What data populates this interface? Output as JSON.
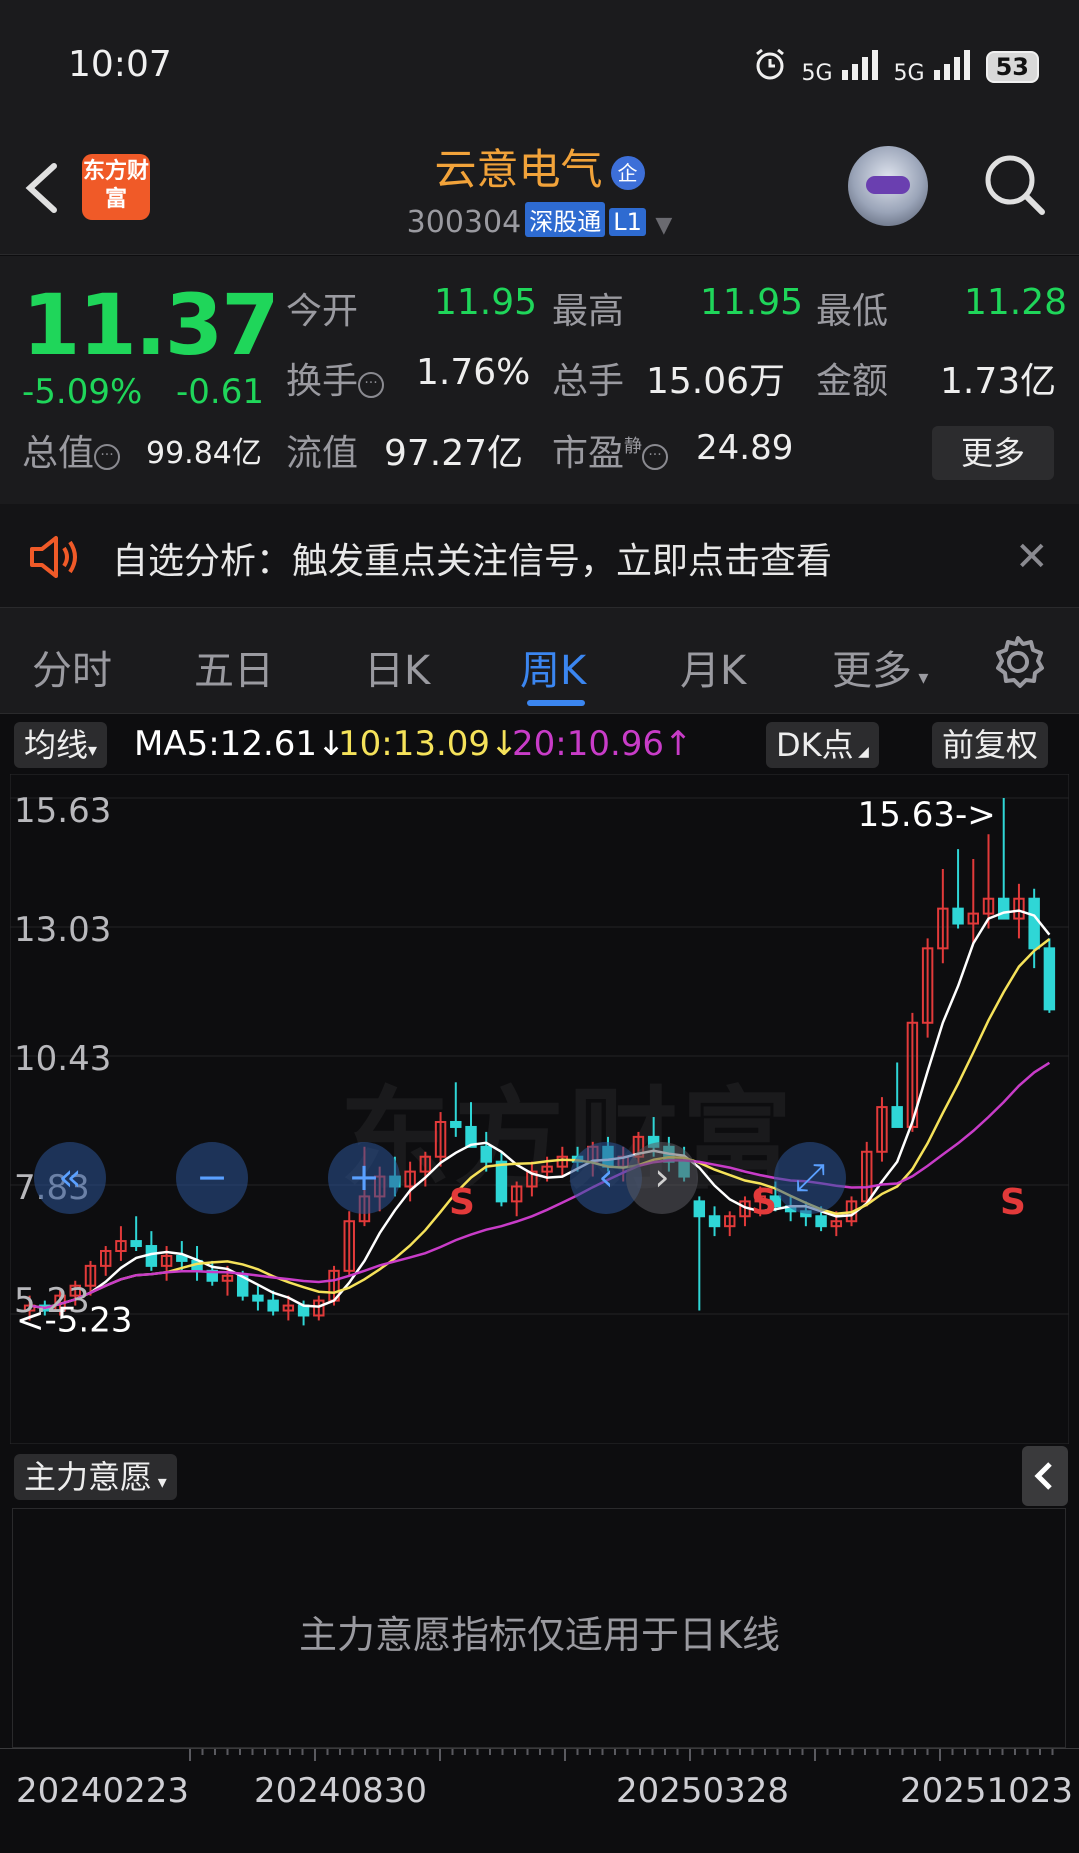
{
  "status": {
    "time": "10:07",
    "net1": "5G",
    "net2": "5G",
    "battery": "53"
  },
  "header": {
    "logo_text": "东方财富",
    "stock_name": "云意电气",
    "name_badge": "企",
    "code": "300304",
    "tag1": "深股通",
    "tag2": "L1"
  },
  "quote": {
    "price": "11.37",
    "change_pct": "-5.09%",
    "change_abs": "-0.61",
    "open_label": "今开",
    "open": "11.95",
    "high_label": "最高",
    "high": "11.95",
    "low_label": "最低",
    "low": "11.28",
    "turnover_label": "换手",
    "turnover": "1.76%",
    "volume_label": "总手",
    "volume": "15.06万",
    "amount_label": "金额",
    "amount": "1.73亿",
    "mktcap_label": "总值",
    "mktcap": "99.84亿",
    "float_label": "流值",
    "float_cap": "97.27亿",
    "pe_label": "市盈",
    "pe_sup": "静",
    "pe": "24.89",
    "more_label": "更多"
  },
  "notice": {
    "text": "自选分析：触发重点关注信号，立即点击查看"
  },
  "tabs": [
    "分时",
    "五日",
    "日K",
    "周K",
    "月K",
    "更多"
  ],
  "active_tab": "周K",
  "ma_bar": {
    "avg_label": "均线",
    "ma5": "MA5:12.61↓",
    "ma10": "10:13.09↓",
    "ma20": "20:10.96↑",
    "dk_label": "DK点",
    "adjust_label": "前复权"
  },
  "colors": {
    "up": "#e23a3a",
    "down": "#2fd6d6",
    "ma5": "#ffffff",
    "ma10": "#f5e25a",
    "ma20": "#c83cc8",
    "accent": "#3b86f0",
    "green": "#1fd65a"
  },
  "chart_data": {
    "type": "candlestick",
    "y_ticks": [
      "15.63",
      "13.03",
      "10.43",
      "7.83",
      "5.23"
    ],
    "ylim": [
      5.23,
      15.63
    ],
    "max_marker": "15.63->",
    "min_marker": "<-5.23",
    "signal_marks": [
      "S",
      "S",
      "S"
    ],
    "watermark": "东方财富",
    "x_dates": [
      "20240223",
      "20240830",
      "20250328",
      "20251023"
    ],
    "candles": [
      [
        5.3,
        5.6,
        5.1,
        5.4
      ],
      [
        5.4,
        5.5,
        5.2,
        5.3
      ],
      [
        5.3,
        5.7,
        5.2,
        5.6
      ],
      [
        5.6,
        5.9,
        5.4,
        5.8
      ],
      [
        5.8,
        6.3,
        5.6,
        6.2
      ],
      [
        6.2,
        6.6,
        6.0,
        6.5
      ],
      [
        6.5,
        7.0,
        6.3,
        6.7
      ],
      [
        6.7,
        7.2,
        6.5,
        6.6
      ],
      [
        6.6,
        6.9,
        6.1,
        6.2
      ],
      [
        6.2,
        6.6,
        5.9,
        6.4
      ],
      [
        6.4,
        6.7,
        6.1,
        6.3
      ],
      [
        6.3,
        6.6,
        5.9,
        6.1
      ],
      [
        6.1,
        6.3,
        5.8,
        5.9
      ],
      [
        5.9,
        6.2,
        5.6,
        6.0
      ],
      [
        6.0,
        6.1,
        5.5,
        5.6
      ],
      [
        5.6,
        5.8,
        5.3,
        5.5
      ],
      [
        5.5,
        5.7,
        5.2,
        5.3
      ],
      [
        5.3,
        5.6,
        5.1,
        5.4
      ],
      [
        5.4,
        5.5,
        5.0,
        5.2
      ],
      [
        5.2,
        5.6,
        5.1,
        5.5
      ],
      [
        5.5,
        6.2,
        5.4,
        6.1
      ],
      [
        6.1,
        7.3,
        6.0,
        7.1
      ],
      [
        7.1,
        8.6,
        7.0,
        7.6
      ],
      [
        7.6,
        8.2,
        7.3,
        8.0
      ],
      [
        8.0,
        8.4,
        7.6,
        7.8
      ],
      [
        7.8,
        8.3,
        7.5,
        8.1
      ],
      [
        8.1,
        8.5,
        7.8,
        8.4
      ],
      [
        8.4,
        9.3,
        8.2,
        9.1
      ],
      [
        9.1,
        9.9,
        8.8,
        9.0
      ],
      [
        9.0,
        9.5,
        8.6,
        8.6
      ],
      [
        8.6,
        8.9,
        8.1,
        8.3
      ],
      [
        8.3,
        8.5,
        7.4,
        7.5
      ],
      [
        7.5,
        7.9,
        7.2,
        7.8
      ],
      [
        7.8,
        8.3,
        7.6,
        8.1
      ],
      [
        8.1,
        8.4,
        7.9,
        8.2
      ],
      [
        8.2,
        8.6,
        8.0,
        8.4
      ],
      [
        8.4,
        8.6,
        8.1,
        8.3
      ],
      [
        8.3,
        8.7,
        8.0,
        8.6
      ],
      [
        8.6,
        8.8,
        8.1,
        8.2
      ],
      [
        8.2,
        8.6,
        7.9,
        8.4
      ],
      [
        8.4,
        8.9,
        8.2,
        8.8
      ],
      [
        8.8,
        9.2,
        8.4,
        8.6
      ],
      [
        8.6,
        8.8,
        8.1,
        8.3
      ],
      [
        8.3,
        8.6,
        7.9,
        8.0
      ],
      [
        7.5,
        7.6,
        5.3,
        7.2
      ],
      [
        7.2,
        7.4,
        6.8,
        7.0
      ],
      [
        7.0,
        7.3,
        6.8,
        7.2
      ],
      [
        7.2,
        7.6,
        7.0,
        7.5
      ],
      [
        7.5,
        7.8,
        7.2,
        7.6
      ],
      [
        7.6,
        7.9,
        7.3,
        7.4
      ],
      [
        7.4,
        7.6,
        7.1,
        7.3
      ],
      [
        7.3,
        7.5,
        7.0,
        7.2
      ],
      [
        7.2,
        7.4,
        6.9,
        7.0
      ],
      [
        7.0,
        7.3,
        6.8,
        7.1
      ],
      [
        7.1,
        7.6,
        7.0,
        7.5
      ],
      [
        7.5,
        8.7,
        7.4,
        8.5
      ],
      [
        8.5,
        9.6,
        8.3,
        9.4
      ],
      [
        9.4,
        10.3,
        9.0,
        9.0
      ],
      [
        9.0,
        11.3,
        8.9,
        11.1
      ],
      [
        11.1,
        12.8,
        10.8,
        12.6
      ],
      [
        12.6,
        14.2,
        12.3,
        13.4
      ],
      [
        13.4,
        14.6,
        13.0,
        13.1
      ],
      [
        13.1,
        14.4,
        12.7,
        13.3
      ],
      [
        13.3,
        14.9,
        13.0,
        13.6
      ],
      [
        13.6,
        15.63,
        13.2,
        13.2
      ],
      [
        13.2,
        13.9,
        12.8,
        13.6
      ],
      [
        13.6,
        13.8,
        12.2,
        12.6
      ],
      [
        12.6,
        12.8,
        11.3,
        11.37
      ]
    ]
  },
  "indicator": {
    "label": "主力意愿",
    "message": "主力意愿指标仅适用于日K线"
  }
}
